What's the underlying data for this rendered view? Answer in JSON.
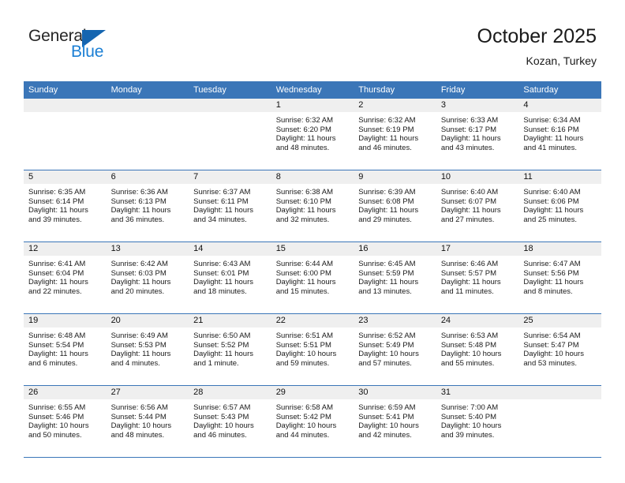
{
  "brand": {
    "name_part1": "General",
    "name_part2": "Blue",
    "triangle_color": "#1565b0",
    "blue_color": "#1b7fd4"
  },
  "header": {
    "title": "October 2025",
    "location": "Kozan, Turkey",
    "accent_color": "#3b76b8",
    "daycell_band_color": "#efefef"
  },
  "weekday_headers": [
    "Sunday",
    "Monday",
    "Tuesday",
    "Wednesday",
    "Thursday",
    "Friday",
    "Saturday"
  ],
  "labels": {
    "sunrise_prefix": "Sunrise:",
    "sunset_prefix": "Sunset:",
    "daylight_prefix": "Daylight:"
  },
  "weeks": [
    [
      {
        "day": "",
        "sunrise": "",
        "sunset": "",
        "daylight_line1": "",
        "daylight_line2": ""
      },
      {
        "day": "",
        "sunrise": "",
        "sunset": "",
        "daylight_line1": "",
        "daylight_line2": ""
      },
      {
        "day": "",
        "sunrise": "",
        "sunset": "",
        "daylight_line1": "",
        "daylight_line2": ""
      },
      {
        "day": "1",
        "sunrise": "Sunrise: 6:32 AM",
        "sunset": "Sunset: 6:20 PM",
        "daylight_line1": "Daylight: 11 hours",
        "daylight_line2": "and 48 minutes."
      },
      {
        "day": "2",
        "sunrise": "Sunrise: 6:32 AM",
        "sunset": "Sunset: 6:19 PM",
        "daylight_line1": "Daylight: 11 hours",
        "daylight_line2": "and 46 minutes."
      },
      {
        "day": "3",
        "sunrise": "Sunrise: 6:33 AM",
        "sunset": "Sunset: 6:17 PM",
        "daylight_line1": "Daylight: 11 hours",
        "daylight_line2": "and 43 minutes."
      },
      {
        "day": "4",
        "sunrise": "Sunrise: 6:34 AM",
        "sunset": "Sunset: 6:16 PM",
        "daylight_line1": "Daylight: 11 hours",
        "daylight_line2": "and 41 minutes."
      }
    ],
    [
      {
        "day": "5",
        "sunrise": "Sunrise: 6:35 AM",
        "sunset": "Sunset: 6:14 PM",
        "daylight_line1": "Daylight: 11 hours",
        "daylight_line2": "and 39 minutes."
      },
      {
        "day": "6",
        "sunrise": "Sunrise: 6:36 AM",
        "sunset": "Sunset: 6:13 PM",
        "daylight_line1": "Daylight: 11 hours",
        "daylight_line2": "and 36 minutes."
      },
      {
        "day": "7",
        "sunrise": "Sunrise: 6:37 AM",
        "sunset": "Sunset: 6:11 PM",
        "daylight_line1": "Daylight: 11 hours",
        "daylight_line2": "and 34 minutes."
      },
      {
        "day": "8",
        "sunrise": "Sunrise: 6:38 AM",
        "sunset": "Sunset: 6:10 PM",
        "daylight_line1": "Daylight: 11 hours",
        "daylight_line2": "and 32 minutes."
      },
      {
        "day": "9",
        "sunrise": "Sunrise: 6:39 AM",
        "sunset": "Sunset: 6:08 PM",
        "daylight_line1": "Daylight: 11 hours",
        "daylight_line2": "and 29 minutes."
      },
      {
        "day": "10",
        "sunrise": "Sunrise: 6:40 AM",
        "sunset": "Sunset: 6:07 PM",
        "daylight_line1": "Daylight: 11 hours",
        "daylight_line2": "and 27 minutes."
      },
      {
        "day": "11",
        "sunrise": "Sunrise: 6:40 AM",
        "sunset": "Sunset: 6:06 PM",
        "daylight_line1": "Daylight: 11 hours",
        "daylight_line2": "and 25 minutes."
      }
    ],
    [
      {
        "day": "12",
        "sunrise": "Sunrise: 6:41 AM",
        "sunset": "Sunset: 6:04 PM",
        "daylight_line1": "Daylight: 11 hours",
        "daylight_line2": "and 22 minutes."
      },
      {
        "day": "13",
        "sunrise": "Sunrise: 6:42 AM",
        "sunset": "Sunset: 6:03 PM",
        "daylight_line1": "Daylight: 11 hours",
        "daylight_line2": "and 20 minutes."
      },
      {
        "day": "14",
        "sunrise": "Sunrise: 6:43 AM",
        "sunset": "Sunset: 6:01 PM",
        "daylight_line1": "Daylight: 11 hours",
        "daylight_line2": "and 18 minutes."
      },
      {
        "day": "15",
        "sunrise": "Sunrise: 6:44 AM",
        "sunset": "Sunset: 6:00 PM",
        "daylight_line1": "Daylight: 11 hours",
        "daylight_line2": "and 15 minutes."
      },
      {
        "day": "16",
        "sunrise": "Sunrise: 6:45 AM",
        "sunset": "Sunset: 5:59 PM",
        "daylight_line1": "Daylight: 11 hours",
        "daylight_line2": "and 13 minutes."
      },
      {
        "day": "17",
        "sunrise": "Sunrise: 6:46 AM",
        "sunset": "Sunset: 5:57 PM",
        "daylight_line1": "Daylight: 11 hours",
        "daylight_line2": "and 11 minutes."
      },
      {
        "day": "18",
        "sunrise": "Sunrise: 6:47 AM",
        "sunset": "Sunset: 5:56 PM",
        "daylight_line1": "Daylight: 11 hours",
        "daylight_line2": "and 8 minutes."
      }
    ],
    [
      {
        "day": "19",
        "sunrise": "Sunrise: 6:48 AM",
        "sunset": "Sunset: 5:54 PM",
        "daylight_line1": "Daylight: 11 hours",
        "daylight_line2": "and 6 minutes."
      },
      {
        "day": "20",
        "sunrise": "Sunrise: 6:49 AM",
        "sunset": "Sunset: 5:53 PM",
        "daylight_line1": "Daylight: 11 hours",
        "daylight_line2": "and 4 minutes."
      },
      {
        "day": "21",
        "sunrise": "Sunrise: 6:50 AM",
        "sunset": "Sunset: 5:52 PM",
        "daylight_line1": "Daylight: 11 hours",
        "daylight_line2": "and 1 minute."
      },
      {
        "day": "22",
        "sunrise": "Sunrise: 6:51 AM",
        "sunset": "Sunset: 5:51 PM",
        "daylight_line1": "Daylight: 10 hours",
        "daylight_line2": "and 59 minutes."
      },
      {
        "day": "23",
        "sunrise": "Sunrise: 6:52 AM",
        "sunset": "Sunset: 5:49 PM",
        "daylight_line1": "Daylight: 10 hours",
        "daylight_line2": "and 57 minutes."
      },
      {
        "day": "24",
        "sunrise": "Sunrise: 6:53 AM",
        "sunset": "Sunset: 5:48 PM",
        "daylight_line1": "Daylight: 10 hours",
        "daylight_line2": "and 55 minutes."
      },
      {
        "day": "25",
        "sunrise": "Sunrise: 6:54 AM",
        "sunset": "Sunset: 5:47 PM",
        "daylight_line1": "Daylight: 10 hours",
        "daylight_line2": "and 53 minutes."
      }
    ],
    [
      {
        "day": "26",
        "sunrise": "Sunrise: 6:55 AM",
        "sunset": "Sunset: 5:46 PM",
        "daylight_line1": "Daylight: 10 hours",
        "daylight_line2": "and 50 minutes."
      },
      {
        "day": "27",
        "sunrise": "Sunrise: 6:56 AM",
        "sunset": "Sunset: 5:44 PM",
        "daylight_line1": "Daylight: 10 hours",
        "daylight_line2": "and 48 minutes."
      },
      {
        "day": "28",
        "sunrise": "Sunrise: 6:57 AM",
        "sunset": "Sunset: 5:43 PM",
        "daylight_line1": "Daylight: 10 hours",
        "daylight_line2": "and 46 minutes."
      },
      {
        "day": "29",
        "sunrise": "Sunrise: 6:58 AM",
        "sunset": "Sunset: 5:42 PM",
        "daylight_line1": "Daylight: 10 hours",
        "daylight_line2": "and 44 minutes."
      },
      {
        "day": "30",
        "sunrise": "Sunrise: 6:59 AM",
        "sunset": "Sunset: 5:41 PM",
        "daylight_line1": "Daylight: 10 hours",
        "daylight_line2": "and 42 minutes."
      },
      {
        "day": "31",
        "sunrise": "Sunrise: 7:00 AM",
        "sunset": "Sunset: 5:40 PM",
        "daylight_line1": "Daylight: 10 hours",
        "daylight_line2": "and 39 minutes."
      },
      {
        "day": "",
        "sunrise": "",
        "sunset": "",
        "daylight_line1": "",
        "daylight_line2": ""
      }
    ]
  ]
}
